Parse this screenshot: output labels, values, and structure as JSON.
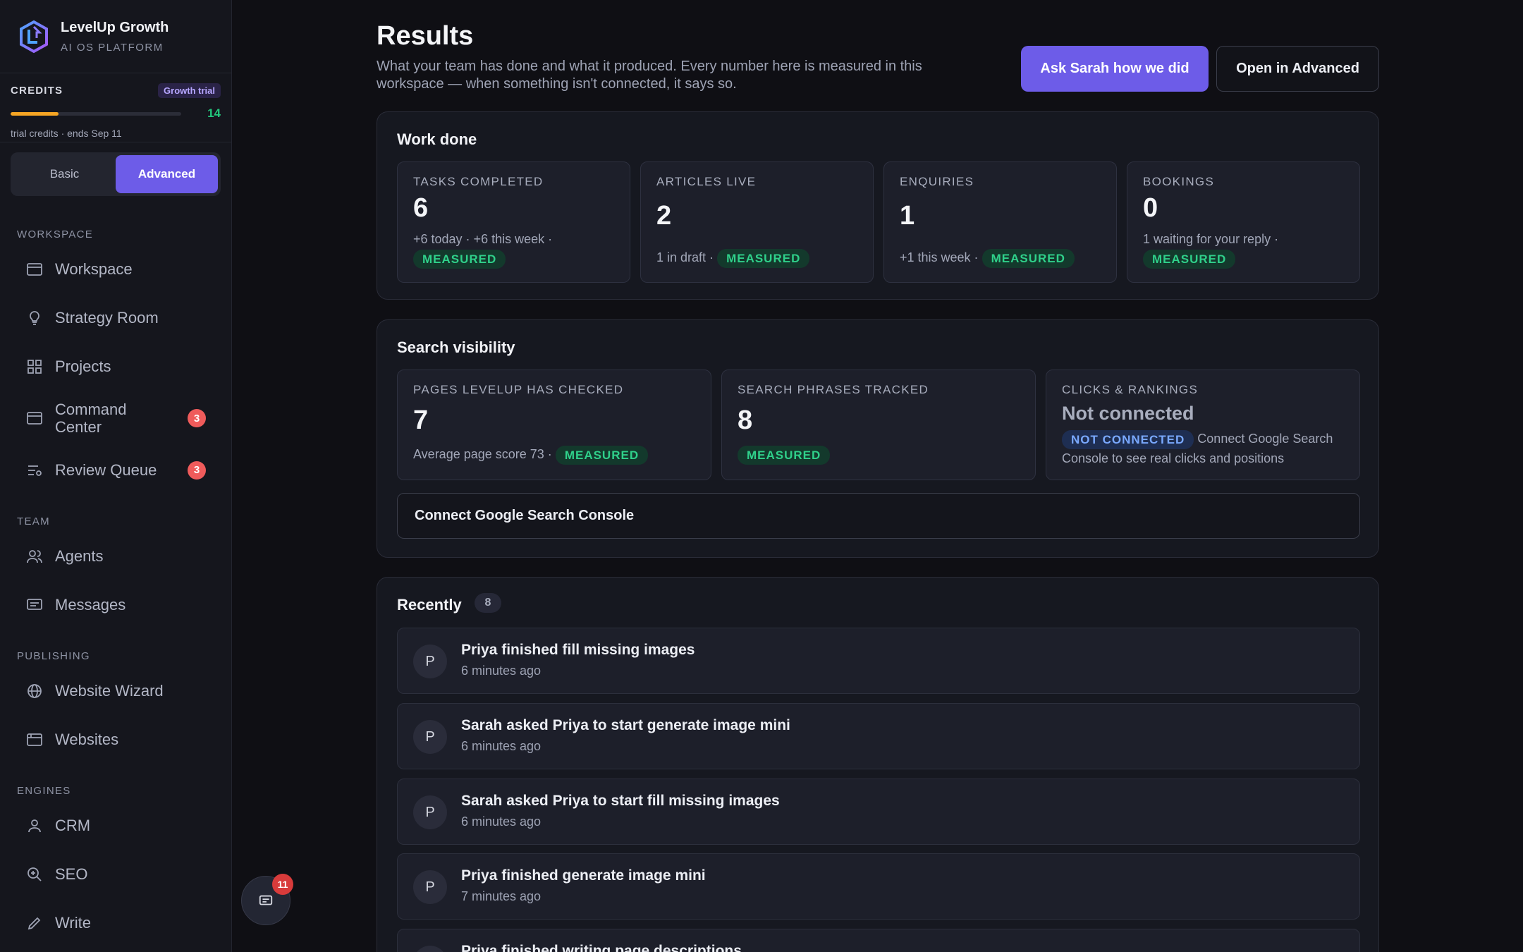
{
  "brand": {
    "name": "LevelUp Growth",
    "subtitle": "AI OS PLATFORM"
  },
  "credits": {
    "label": "CREDITS",
    "plan_badge": "Growth trial",
    "remaining": "14",
    "fill_fraction": 0.28,
    "note": "trial credits · ends Sep 11",
    "accent_color": "#f5a524"
  },
  "mode": {
    "basic": "Basic",
    "advanced": "Advanced",
    "selected": "Advanced"
  },
  "nav": {
    "workspace_heading": "WORKSPACE",
    "team_heading": "TEAM",
    "publishing_heading": "PUBLISHING",
    "engines_heading": "ENGINES",
    "items": {
      "workspace": "Workspace",
      "strategy_room": "Strategy Room",
      "projects": "Projects",
      "command_center": "Command Center",
      "command_center_badge": "3",
      "review_queue": "Review Queue",
      "review_queue_badge": "3",
      "agents": "Agents",
      "messages": "Messages",
      "website_wizard": "Website Wizard",
      "websites": "Websites",
      "crm": "CRM",
      "seo": "SEO",
      "write": "Write"
    }
  },
  "header": {
    "title": "Results",
    "subtitle": "What your team has done and what it produced. Every number here is measured in this workspace — when something isn't connected, it says so.",
    "ask_button": "Ask Sarah how we did",
    "advanced_button": "Open in Advanced"
  },
  "work_done": {
    "title": "Work done",
    "cards": [
      {
        "label": "TASKS COMPLETED",
        "value": "6",
        "meta": "+6 today · +6 this week ·",
        "pill": "MEASURED"
      },
      {
        "label": "ARTICLES LIVE",
        "value": "2",
        "meta": "1 in draft ·",
        "pill": "MEASURED"
      },
      {
        "label": "ENQUIRIES",
        "value": "1",
        "meta": "+1 this week ·",
        "pill": "MEASURED"
      },
      {
        "label": "BOOKINGS",
        "value": "0",
        "meta": "1 waiting for your reply ·",
        "pill": "MEASURED"
      }
    ]
  },
  "search_visibility": {
    "title": "Search visibility",
    "cards": [
      {
        "label": "PAGES LEVELUP HAS CHECKED",
        "value": "7",
        "meta": "Average page score 73 ·",
        "pill": "MEASURED"
      },
      {
        "label": "SEARCH PHRASES TRACKED",
        "value": "8",
        "meta": "",
        "pill": "MEASURED"
      },
      {
        "label": "CLICKS & RANKINGS",
        "value": "Not connected",
        "pill": "NOT CONNECTED",
        "meta": "Connect Google Search Console to see real clicks and positions"
      }
    ],
    "connect_button": "Connect Google Search Console"
  },
  "recently": {
    "title": "Recently",
    "count": "8",
    "items": [
      {
        "avatar": "P",
        "title": "Priya finished fill missing images",
        "time": "6 minutes ago"
      },
      {
        "avatar": "P",
        "title": "Sarah asked Priya to start generate image mini",
        "time": "6 minutes ago"
      },
      {
        "avatar": "P",
        "title": "Sarah asked Priya to start fill missing images",
        "time": "6 minutes ago"
      },
      {
        "avatar": "P",
        "title": "Priya finished generate image mini",
        "time": "7 minutes ago"
      },
      {
        "avatar": "P",
        "title": "Priya finished writing page descriptions",
        "time": ""
      }
    ]
  },
  "chat_fab": {
    "badge": "11",
    "icon": "chat-icon"
  },
  "colors": {
    "accent": "#6d5ce8",
    "measured": "#2fd08a",
    "not_connected": "#7aa9ff",
    "badge": "#ef5b5b"
  }
}
